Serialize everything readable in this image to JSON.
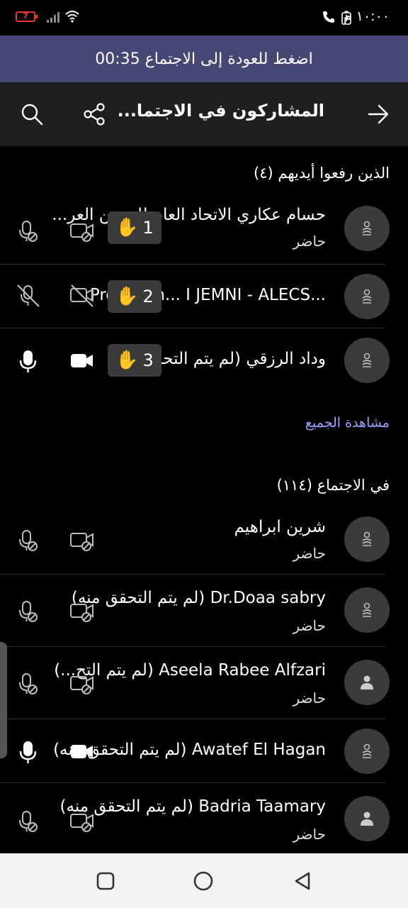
{
  "status_bar": {
    "time": "١٠:٠٠ م",
    "battery": "7"
  },
  "banner": {
    "text": "اضغط للعودة إلى الاجتماع 00:35"
  },
  "header": {
    "title": "المشاركون في الاجتما..."
  },
  "raised": {
    "title": "الذين رفعوا أيديهم (٤)",
    "rows": [
      {
        "name": "حسام عكاري الاتحاد العام للحجين العر...",
        "status": "حاضر",
        "hand": "1"
      },
      {
        "name": "Prof. Moh... I JEMNI - ALECS...",
        "status": "",
        "hand": "2"
      },
      {
        "name": "وداد الرزقي (لم يتم التحقق منه)",
        "status": "",
        "hand": "3"
      }
    ]
  },
  "see_all": "مشاهدة الجميع",
  "meeting": {
    "title": "في الاجتماع (١١٤)",
    "rows": [
      {
        "name": "شرين ابراهيم",
        "status": "حاضر"
      },
      {
        "name": "Dr.Doaa sabry (لم يتم التحقق منه)",
        "status": "حاضر"
      },
      {
        "name": "Aseela Rabee Alfzari (لم يتم التح...)",
        "status": "حاضر"
      },
      {
        "name": "Awatef El Hagan (لم يتم التحقق منه)",
        "status": ""
      },
      {
        "name": "Badria Taamary (لم يتم التحقق منه)",
        "status": "حاضر"
      }
    ]
  },
  "icons": {
    "back": "arrow-right-icon",
    "share": "share-icon",
    "search": "search-icon",
    "mic_off": "mic-off-icon",
    "mic_on": "mic-on-icon",
    "cam_off": "camera-off-icon",
    "cam_on": "camera-on-icon",
    "hand": "raised-hand-icon",
    "avatar": "person-icon"
  },
  "colors": {
    "banner": "#464775",
    "header": "#1f1f1f",
    "link": "#9ea2ff",
    "hand_badge": "#3a3a3a"
  }
}
